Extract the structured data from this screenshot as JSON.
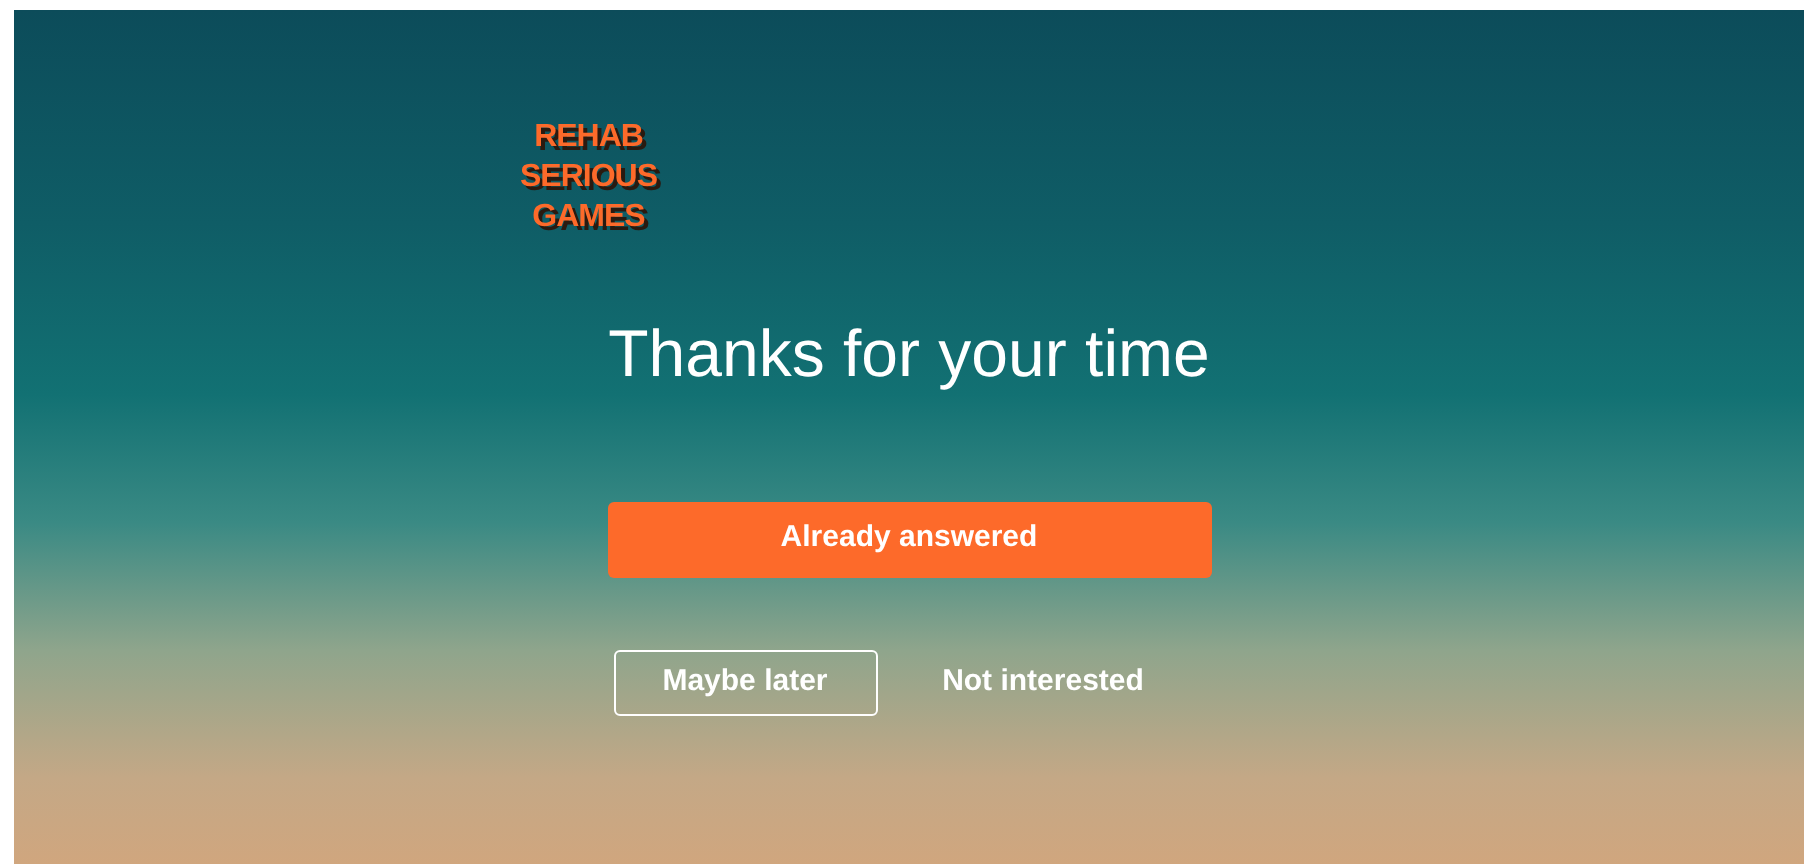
{
  "logo": {
    "lines": [
      "REHAB",
      "SERIOUS",
      "GAMES"
    ]
  },
  "title": "Thanks for your time",
  "primary_button": "Already answered",
  "secondary_buttons": [
    {
      "label": "Maybe later",
      "kind": "outline"
    },
    {
      "label": "Not interested",
      "kind": "plain"
    }
  ]
}
